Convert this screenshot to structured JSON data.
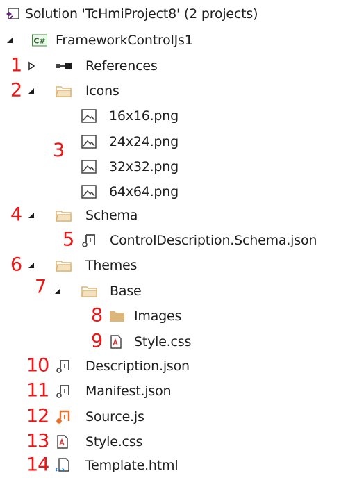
{
  "tree": {
    "solution": {
      "label": "Solution 'TcHmiProject8' (2 projects)"
    },
    "project": {
      "label": "FrameworkControlJs1",
      "badge": "C#"
    },
    "references": {
      "label": "References",
      "marker": "1"
    },
    "icons_folder": {
      "label": "Icons",
      "marker": "2"
    },
    "icons_marker": "3",
    "icon_files": [
      {
        "label": "16x16.png"
      },
      {
        "label": "24x24.png"
      },
      {
        "label": "32x32.png"
      },
      {
        "label": "64x64.png"
      }
    ],
    "schema_folder": {
      "label": "Schema",
      "marker": "4"
    },
    "schema_file": {
      "label": "ControlDescription.Schema.json",
      "marker": "5"
    },
    "themes_folder": {
      "label": "Themes",
      "marker": "6"
    },
    "base_folder": {
      "label": "Base",
      "marker": "7"
    },
    "images_folder": {
      "label": "Images",
      "marker": "8"
    },
    "base_style": {
      "label": "Style.css",
      "marker": "9"
    },
    "description": {
      "label": "Description.json",
      "marker": "10"
    },
    "manifest": {
      "label": "Manifest.json",
      "marker": "11"
    },
    "source": {
      "label": "Source.js",
      "marker": "12"
    },
    "style": {
      "label": "Style.css",
      "marker": "13"
    },
    "template": {
      "label": "Template.html",
      "marker": "14"
    }
  },
  "colors": {
    "marker": "#f01414",
    "folder": "#dcb67a",
    "json_icon": "#424242",
    "js_icon": "#e8702a",
    "html_icon_accent": "#1f7bd8",
    "solution_icon": "#68217a"
  }
}
